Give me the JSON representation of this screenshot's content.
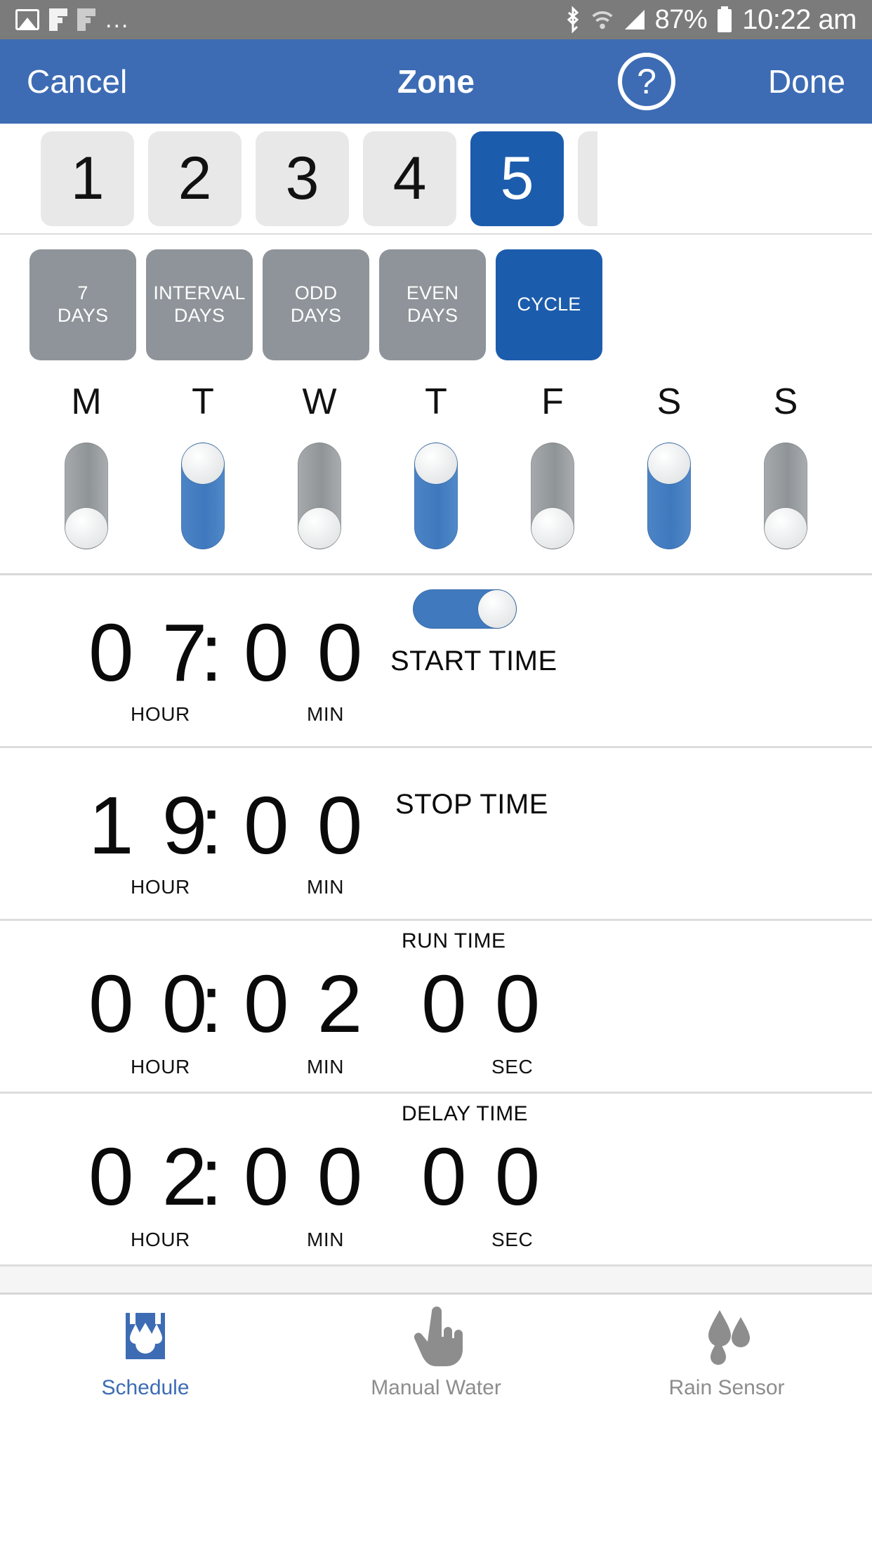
{
  "statusbar": {
    "icons_left": [
      "photo-icon",
      "f-icon",
      "f-icon-dim",
      "overflow-dots-icon"
    ],
    "dots": "...",
    "bluetooth_icon": "bluetooth-icon",
    "wifi_icon": "wifi-icon",
    "signal_icon": "cell-signal-icon",
    "battery_percent": "87%",
    "battery_icon": "battery-icon",
    "time": "10:22 am"
  },
  "navbar": {
    "cancel_label": "Cancel",
    "title": "Zone",
    "help_label": "?",
    "done_label": "Done",
    "bg_color": "#3d6cb4"
  },
  "zones": {
    "items": [
      {
        "label": "1",
        "selected": false
      },
      {
        "label": "2",
        "selected": false
      },
      {
        "label": "3",
        "selected": false
      },
      {
        "label": "4",
        "selected": false
      },
      {
        "label": "5",
        "selected": true
      }
    ],
    "selected_color": "#1c5cad",
    "unselected_color": "#e8e8e8"
  },
  "modes": {
    "items": [
      {
        "label": "7\nDAYS",
        "selected": false
      },
      {
        "label": "INTERVAL\nDAYS",
        "selected": false
      },
      {
        "label": "ODD\nDAYS",
        "selected": false
      },
      {
        "label": "EVEN\nDAYS",
        "selected": false
      },
      {
        "label": "CYCLE",
        "selected": true
      }
    ],
    "selected_color": "#1c5cad",
    "unselected_color": "#8e9499"
  },
  "days": {
    "letters": [
      "M",
      "T",
      "W",
      "T",
      "F",
      "S",
      "S"
    ],
    "states": [
      false,
      true,
      false,
      true,
      false,
      true,
      false
    ],
    "on_color": "#4079bd",
    "off_color": "#9a9ea1"
  },
  "start_time": {
    "hour": "0 7",
    "sep": ":",
    "min": "0 0",
    "hour_cap": "HOUR",
    "min_cap": "MIN",
    "label": "START TIME",
    "toggle_on": true
  },
  "stop_time": {
    "hour": "1 9",
    "sep": ":",
    "min": "0 0",
    "hour_cap": "HOUR",
    "min_cap": "MIN",
    "label": "STOP TIME"
  },
  "run_time": {
    "title": "RUN TIME",
    "hour": "0 0",
    "sep": ":",
    "min": "0 2",
    "sec": "0 0",
    "hour_cap": "HOUR",
    "min_cap": "MIN",
    "sec_cap": "SEC"
  },
  "delay_time": {
    "title": "DELAY TIME",
    "hour": "0 2",
    "sep": ":",
    "min": "0 0",
    "sec": "0 0",
    "hour_cap": "HOUR",
    "min_cap": "MIN",
    "sec_cap": "SEC"
  },
  "tabbar": {
    "items": [
      {
        "label": "Schedule",
        "icon": "schedule-water-drops-icon",
        "active": true
      },
      {
        "label": "Manual Water",
        "icon": "pointing-hand-icon",
        "active": false
      },
      {
        "label": "Rain Sensor",
        "icon": "raindrops-icon",
        "active": false
      }
    ],
    "active_color": "#3d6cb4",
    "inactive_color": "#8d8d8d"
  }
}
